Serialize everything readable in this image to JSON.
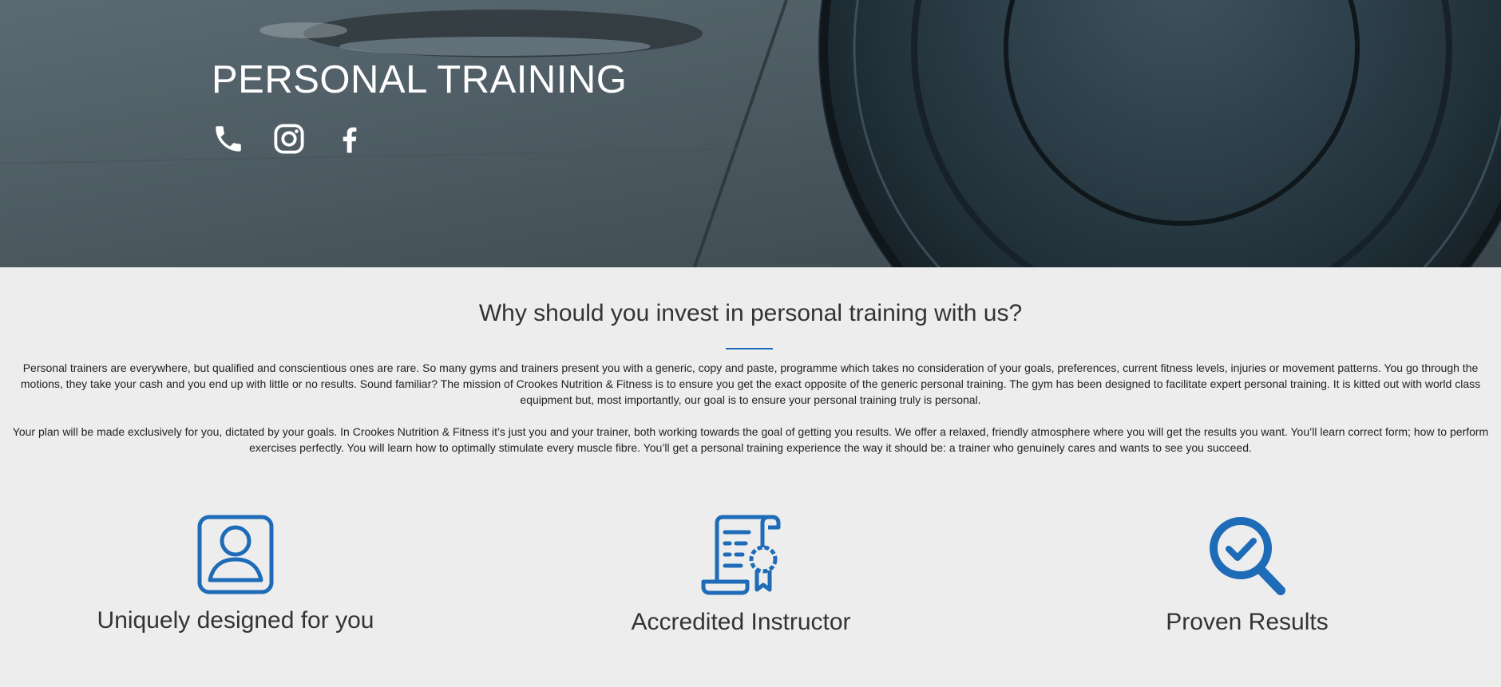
{
  "hero": {
    "title": "PERSONAL TRAINING",
    "icons": [
      "phone-icon",
      "instagram-icon",
      "facebook-icon"
    ]
  },
  "intro": {
    "heading": "Why should you invest in personal training with us?",
    "paragraph_1": "Personal trainers are everywhere, but qualified and conscientious ones are rare. So many gyms and trainers present you with a generic, copy and paste, programme which takes no consideration of your goals, preferences, current fitness levels, injuries or movement patterns. You go through the motions, they take your cash and you end up with little or no results. Sound familiar? The mission of Crookes Nutrition & Fitness is to ensure you get the exact opposite of the generic personal training. The gym has been designed to facilitate expert personal training. It is kitted out with world class equipment but, most importantly, our goal is to ensure your personal training truly is personal.",
    "paragraph_2": "Your plan will be made exclusively for you, dictated by your goals. In Crookes Nutrition & Fitness it’s just you and your trainer, both working towards the goal of getting you results. We offer a relaxed, friendly atmosphere where you will get the results you want. You’ll learn correct form; how to perform exercises perfectly. You will learn how to optimally stimulate every muscle fibre. You’ll get a personal training experience the way it should be: a trainer who genuinely cares and wants to see you succeed."
  },
  "features": [
    {
      "icon": "user-profile-icon",
      "label": "Uniquely designed for you"
    },
    {
      "icon": "certificate-icon",
      "label": "Accredited Instructor"
    },
    {
      "icon": "magnifier-check-icon",
      "label": "Proven Results"
    }
  ],
  "colors": {
    "accent": "#1e6bb8",
    "background": "#ededed",
    "text": "#333333",
    "hero_text": "#ffffff"
  }
}
